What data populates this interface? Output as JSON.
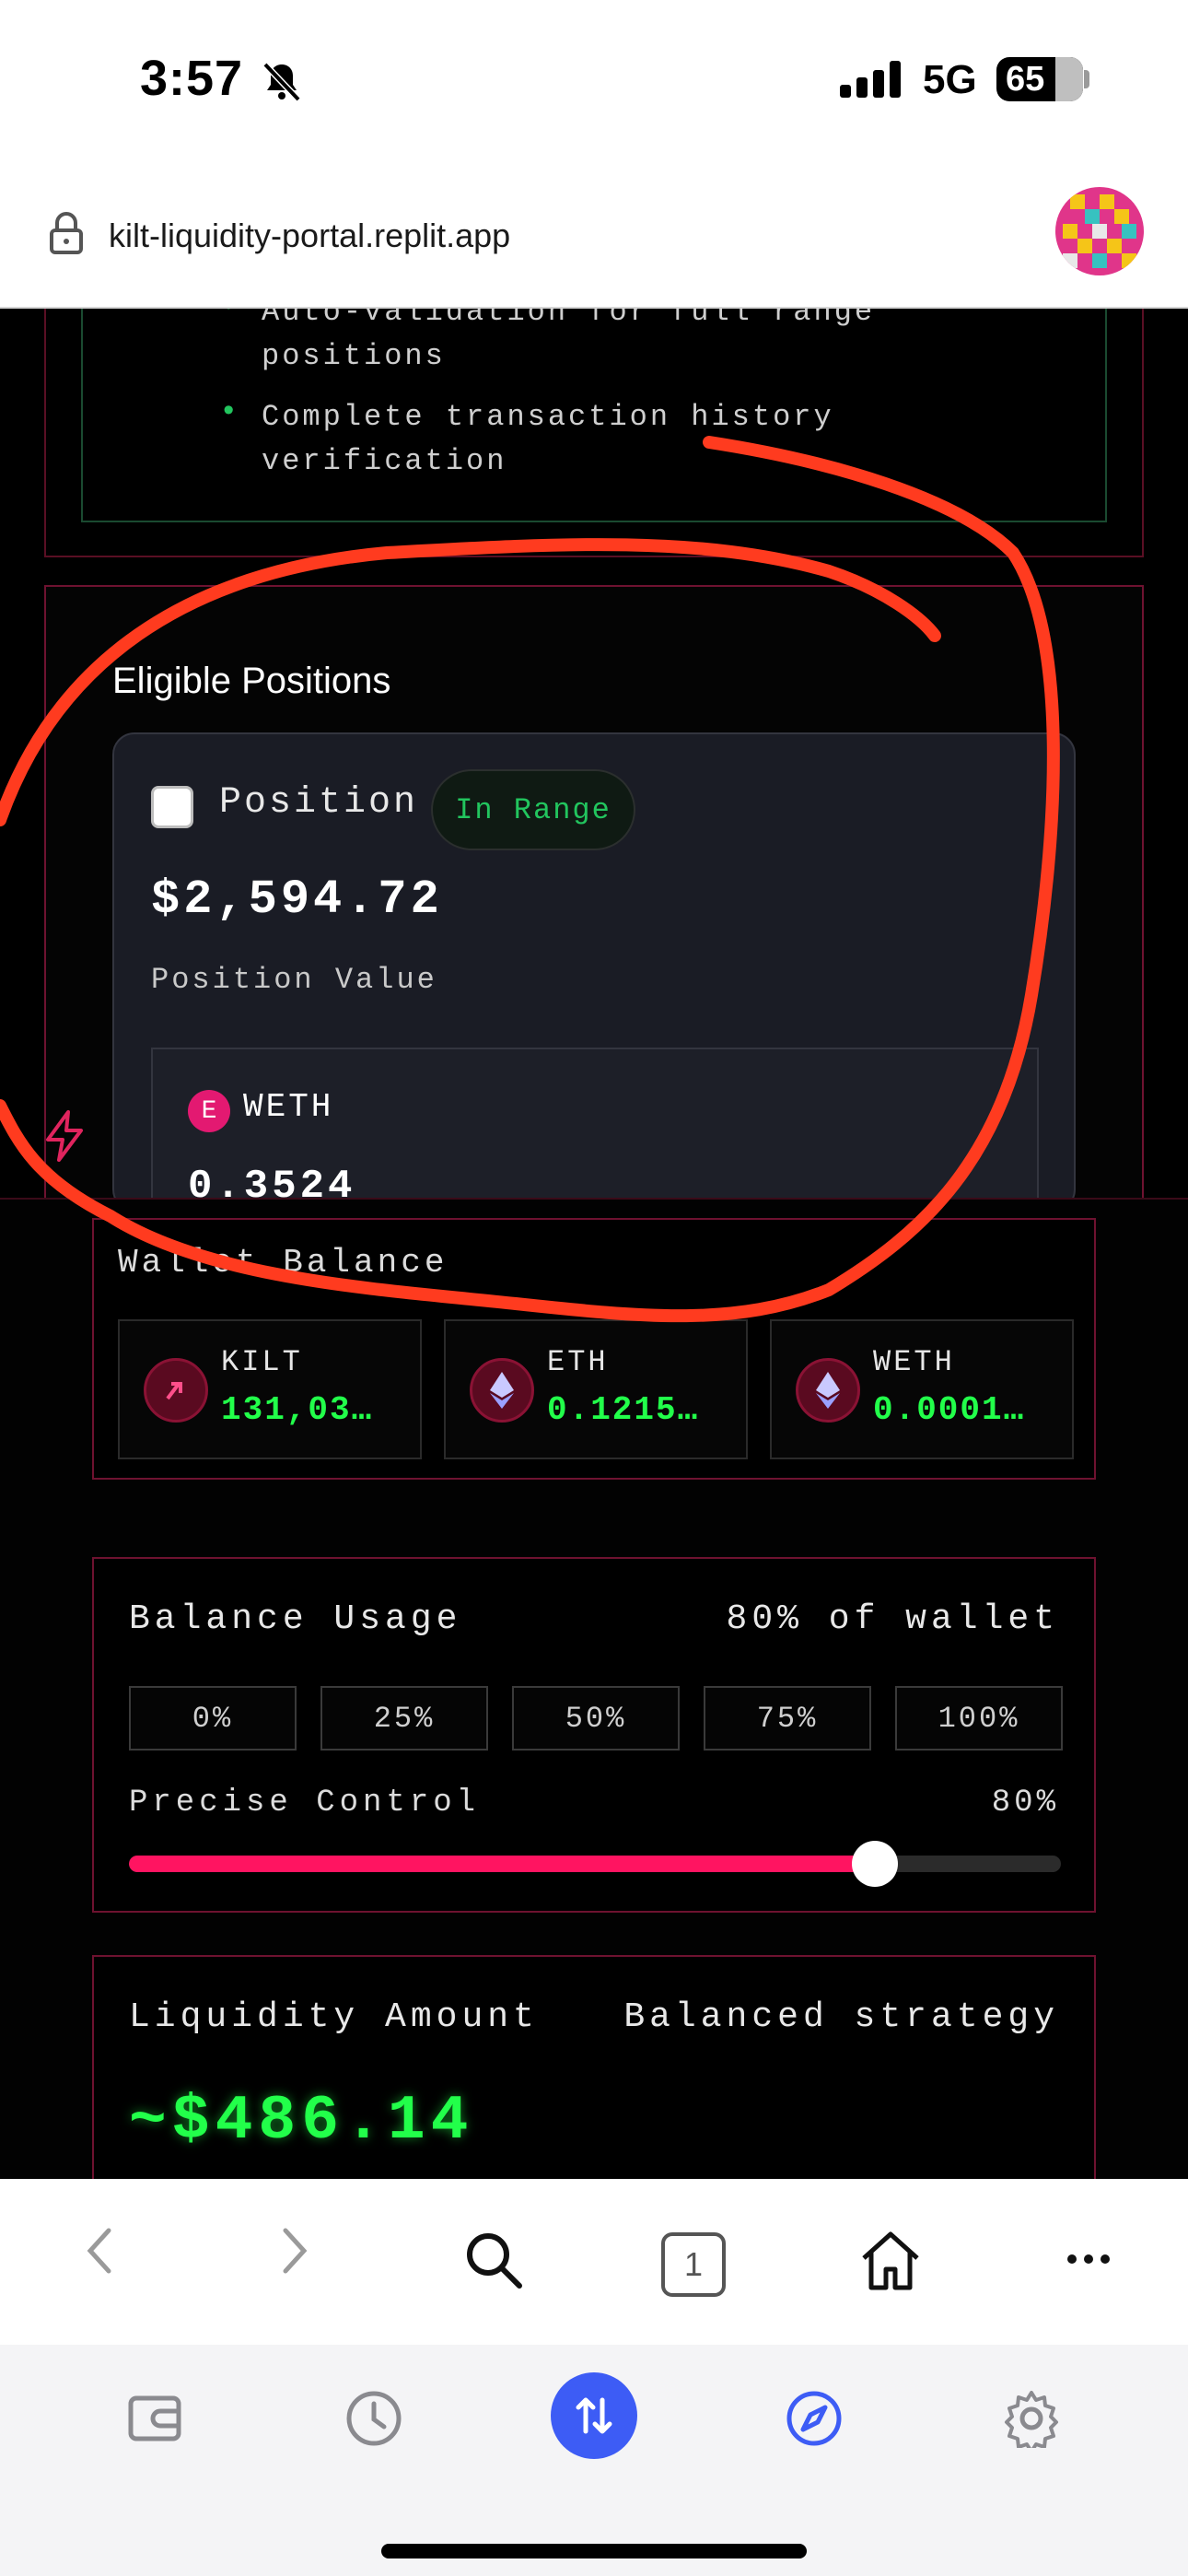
{
  "status": {
    "time": "3:57",
    "network": "5G",
    "battery": "65"
  },
  "browser": {
    "url": "kilt-liquidity-portal.replit.app",
    "tab_count": "1"
  },
  "top_card": {
    "items": [
      {
        "line1": "Auto-validation for full range",
        "line2": "positions"
      },
      {
        "line1": "Complete transaction history",
        "line2": "verification"
      }
    ]
  },
  "eligible": {
    "title": "Eligible Positions",
    "position_label": "Position",
    "status_badge": "In Range",
    "value": "$2,594.72",
    "value_label": "Position Value",
    "token_badge": "E",
    "token_name": "WETH",
    "token_amount": "0.3524"
  },
  "wallet": {
    "title": "Wallet Balance",
    "tokens": [
      {
        "name": "KILT",
        "value": "131,03…"
      },
      {
        "name": "ETH",
        "value": "0.1215…"
      },
      {
        "name": "WETH",
        "value": "0.0001…"
      }
    ]
  },
  "usage": {
    "title": "Balance Usage",
    "summary": "80% of wallet",
    "presets": [
      "0%",
      "25%",
      "50%",
      "75%",
      "100%"
    ],
    "precise_label": "Precise Control",
    "precise_value": "80%",
    "slider_fraction": 0.8
  },
  "liquidity": {
    "title": "Liquidity Amount",
    "strategy": "Balanced strategy",
    "amount": "~$486.14"
  },
  "colors": {
    "accent": "#ff1461",
    "positive": "#22ff4a",
    "border": "#6e1230",
    "app_primary": "#3d5cf5"
  },
  "icons": {
    "toolbar": [
      "back-icon",
      "forward-icon",
      "search-icon",
      "tabs-icon",
      "home-icon",
      "more-icon"
    ],
    "appbar": [
      "wallet-icon",
      "history-icon",
      "swap-icon",
      "explore-icon",
      "settings-icon"
    ]
  }
}
